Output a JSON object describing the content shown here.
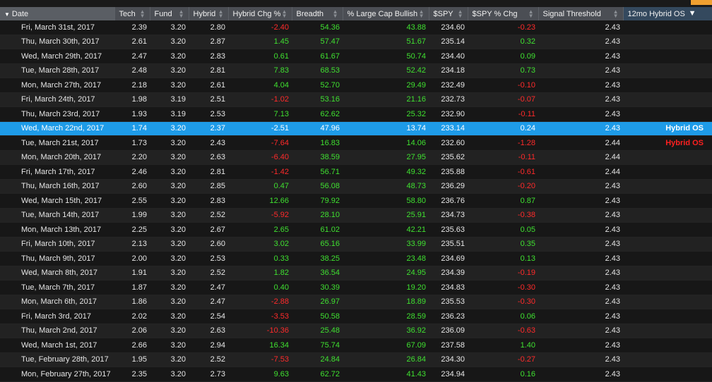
{
  "columns": [
    {
      "label": "Date",
      "key": "date"
    },
    {
      "label": "Tech",
      "key": "tech"
    },
    {
      "label": "Fund",
      "key": "fund"
    },
    {
      "label": "Hybrid",
      "key": "hybrid"
    },
    {
      "label": "Hybrid Chg %",
      "key": "hchg"
    },
    {
      "label": "Breadth",
      "key": "breadth"
    },
    {
      "label": "% Large Cap Bullish",
      "key": "lcb"
    },
    {
      "label": "$SPY",
      "key": "spy"
    },
    {
      "label": "$SPY % Chg",
      "key": "spychg"
    },
    {
      "label": "Signal Threshold",
      "key": "thresh"
    },
    {
      "label": "12mo Hybrid OS",
      "key": "os"
    }
  ],
  "colors": {
    "positive": "#3fe030",
    "negative": "#ff2a2a",
    "selected_row": "#1e9be8",
    "accent": "#f0a030"
  },
  "icons": {
    "sort": "sort-arrows-icon",
    "sort_active": "sort-desc-icon",
    "filter": "filter-icon"
  },
  "selected_index": 7,
  "rows": [
    {
      "date": "Fri, March 31st, 2017",
      "tech": "2.39",
      "fund": "3.20",
      "hybrid": "2.80",
      "hchg": "-2.40",
      "breadth": "54.36",
      "lcb": "43.88",
      "spy": "234.60",
      "spychg": "-0.23",
      "thresh": "2.43",
      "os": ""
    },
    {
      "date": "Thu, March 30th, 2017",
      "tech": "2.61",
      "fund": "3.20",
      "hybrid": "2.87",
      "hchg": "1.45",
      "breadth": "57.47",
      "lcb": "51.67",
      "spy": "235.14",
      "spychg": "0.32",
      "thresh": "2.43",
      "os": ""
    },
    {
      "date": "Wed, March 29th, 2017",
      "tech": "2.47",
      "fund": "3.20",
      "hybrid": "2.83",
      "hchg": "0.61",
      "breadth": "61.67",
      "lcb": "50.74",
      "spy": "234.40",
      "spychg": "0.09",
      "thresh": "2.43",
      "os": ""
    },
    {
      "date": "Tue, March 28th, 2017",
      "tech": "2.48",
      "fund": "3.20",
      "hybrid": "2.81",
      "hchg": "7.83",
      "breadth": "68.53",
      "lcb": "52.42",
      "spy": "234.18",
      "spychg": "0.73",
      "thresh": "2.43",
      "os": ""
    },
    {
      "date": "Mon, March 27th, 2017",
      "tech": "2.18",
      "fund": "3.20",
      "hybrid": "2.61",
      "hchg": "4.04",
      "breadth": "52.70",
      "lcb": "29.49",
      "spy": "232.49",
      "spychg": "-0.10",
      "thresh": "2.43",
      "os": ""
    },
    {
      "date": "Fri, March 24th, 2017",
      "tech": "1.98",
      "fund": "3.19",
      "hybrid": "2.51",
      "hchg": "-1.02",
      "breadth": "53.16",
      "lcb": "21.16",
      "spy": "232.73",
      "spychg": "-0.07",
      "thresh": "2.43",
      "os": ""
    },
    {
      "date": "Thu, March 23rd, 2017",
      "tech": "1.93",
      "fund": "3.19",
      "hybrid": "2.53",
      "hchg": "7.13",
      "breadth": "62.62",
      "lcb": "25.32",
      "spy": "232.90",
      "spychg": "-0.11",
      "thresh": "2.43",
      "os": ""
    },
    {
      "date": "Wed, March 22nd, 2017",
      "tech": "1.74",
      "fund": "3.20",
      "hybrid": "2.37",
      "hchg": "-2.51",
      "breadth": "47.96",
      "lcb": "13.74",
      "spy": "233.14",
      "spychg": "0.24",
      "thresh": "2.43",
      "os": "Hybrid OS"
    },
    {
      "date": "Tue, March 21st, 2017",
      "tech": "1.73",
      "fund": "3.20",
      "hybrid": "2.43",
      "hchg": "-7.64",
      "breadth": "16.83",
      "lcb": "14.06",
      "spy": "232.60",
      "spychg": "-1.28",
      "thresh": "2.44",
      "os": "Hybrid OS"
    },
    {
      "date": "Mon, March 20th, 2017",
      "tech": "2.20",
      "fund": "3.20",
      "hybrid": "2.63",
      "hchg": "-6.40",
      "breadth": "38.59",
      "lcb": "27.95",
      "spy": "235.62",
      "spychg": "-0.11",
      "thresh": "2.44",
      "os": ""
    },
    {
      "date": "Fri, March 17th, 2017",
      "tech": "2.46",
      "fund": "3.20",
      "hybrid": "2.81",
      "hchg": "-1.42",
      "breadth": "56.71",
      "lcb": "49.32",
      "spy": "235.88",
      "spychg": "-0.61",
      "thresh": "2.44",
      "os": ""
    },
    {
      "date": "Thu, March 16th, 2017",
      "tech": "2.60",
      "fund": "3.20",
      "hybrid": "2.85",
      "hchg": "0.47",
      "breadth": "56.08",
      "lcb": "48.73",
      "spy": "236.29",
      "spychg": "-0.20",
      "thresh": "2.43",
      "os": ""
    },
    {
      "date": "Wed, March 15th, 2017",
      "tech": "2.55",
      "fund": "3.20",
      "hybrid": "2.83",
      "hchg": "12.66",
      "breadth": "79.92",
      "lcb": "58.80",
      "spy": "236.76",
      "spychg": "0.87",
      "thresh": "2.43",
      "os": ""
    },
    {
      "date": "Tue, March 14th, 2017",
      "tech": "1.99",
      "fund": "3.20",
      "hybrid": "2.52",
      "hchg": "-5.92",
      "breadth": "28.10",
      "lcb": "25.91",
      "spy": "234.73",
      "spychg": "-0.38",
      "thresh": "2.43",
      "os": ""
    },
    {
      "date": "Mon, March 13th, 2017",
      "tech": "2.25",
      "fund": "3.20",
      "hybrid": "2.67",
      "hchg": "2.65",
      "breadth": "61.02",
      "lcb": "42.21",
      "spy": "235.63",
      "spychg": "0.05",
      "thresh": "2.43",
      "os": ""
    },
    {
      "date": "Fri, March 10th, 2017",
      "tech": "2.13",
      "fund": "3.20",
      "hybrid": "2.60",
      "hchg": "3.02",
      "breadth": "65.16",
      "lcb": "33.99",
      "spy": "235.51",
      "spychg": "0.35",
      "thresh": "2.43",
      "os": ""
    },
    {
      "date": "Thu, March 9th, 2017",
      "tech": "2.00",
      "fund": "3.20",
      "hybrid": "2.53",
      "hchg": "0.33",
      "breadth": "38.25",
      "lcb": "23.48",
      "spy": "234.69",
      "spychg": "0.13",
      "thresh": "2.43",
      "os": ""
    },
    {
      "date": "Wed, March 8th, 2017",
      "tech": "1.91",
      "fund": "3.20",
      "hybrid": "2.52",
      "hchg": "1.82",
      "breadth": "36.54",
      "lcb": "24.95",
      "spy": "234.39",
      "spychg": "-0.19",
      "thresh": "2.43",
      "os": ""
    },
    {
      "date": "Tue, March 7th, 2017",
      "tech": "1.87",
      "fund": "3.20",
      "hybrid": "2.47",
      "hchg": "0.40",
      "breadth": "30.39",
      "lcb": "19.20",
      "spy": "234.83",
      "spychg": "-0.30",
      "thresh": "2.43",
      "os": ""
    },
    {
      "date": "Mon, March 6th, 2017",
      "tech": "1.86",
      "fund": "3.20",
      "hybrid": "2.47",
      "hchg": "-2.88",
      "breadth": "26.97",
      "lcb": "18.89",
      "spy": "235.53",
      "spychg": "-0.30",
      "thresh": "2.43",
      "os": ""
    },
    {
      "date": "Fri, March 3rd, 2017",
      "tech": "2.02",
      "fund": "3.20",
      "hybrid": "2.54",
      "hchg": "-3.53",
      "breadth": "50.58",
      "lcb": "28.59",
      "spy": "236.23",
      "spychg": "0.06",
      "thresh": "2.43",
      "os": ""
    },
    {
      "date": "Thu, March 2nd, 2017",
      "tech": "2.06",
      "fund": "3.20",
      "hybrid": "2.63",
      "hchg": "-10.36",
      "breadth": "25.48",
      "lcb": "36.92",
      "spy": "236.09",
      "spychg": "-0.63",
      "thresh": "2.43",
      "os": ""
    },
    {
      "date": "Wed, March 1st, 2017",
      "tech": "2.66",
      "fund": "3.20",
      "hybrid": "2.94",
      "hchg": "16.34",
      "breadth": "75.74",
      "lcb": "67.09",
      "spy": "237.58",
      "spychg": "1.40",
      "thresh": "2.43",
      "os": ""
    },
    {
      "date": "Tue, February 28th, 2017",
      "tech": "1.95",
      "fund": "3.20",
      "hybrid": "2.52",
      "hchg": "-7.53",
      "breadth": "24.84",
      "lcb": "26.84",
      "spy": "234.30",
      "spychg": "-0.27",
      "thresh": "2.43",
      "os": ""
    },
    {
      "date": "Mon, February 27th, 2017",
      "tech": "2.35",
      "fund": "3.20",
      "hybrid": "2.73",
      "hchg": "9.63",
      "breadth": "62.72",
      "lcb": "41.43",
      "spy": "234.94",
      "spychg": "0.16",
      "thresh": "2.43",
      "os": ""
    }
  ]
}
